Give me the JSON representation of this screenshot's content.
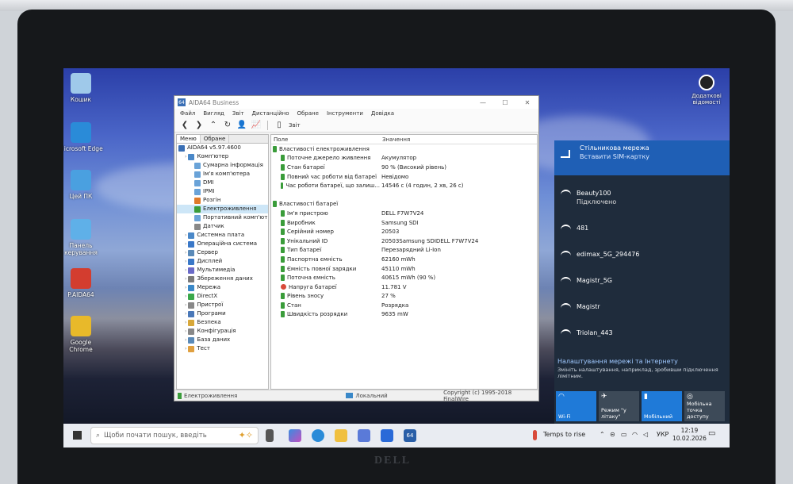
{
  "desktop": {
    "icons": [
      {
        "label": "Кошик",
        "icon": "recycle-bin-icon",
        "color": "#9fc9ea"
      },
      {
        "label": "Microsoft Edge",
        "icon": "edge-icon",
        "color": "#2a8bd8"
      },
      {
        "label": "Цей ПК",
        "icon": "this-pc-icon",
        "color": "#4aa0e0"
      },
      {
        "label": "Панель керування",
        "icon": "control-panel-icon",
        "color": "#5fb0e8"
      },
      {
        "label": "P.AIDA64",
        "icon": "aida64-icon",
        "color": "#d33d2f"
      },
      {
        "label": "Google Chrome",
        "icon": "chrome-icon",
        "color": "#e8b92a"
      }
    ],
    "top_right_label": "Додаткові відомості"
  },
  "window": {
    "title": "AIDA64 Business",
    "icon_text": "64",
    "menu": [
      "Файл",
      "Вигляд",
      "Звіт",
      "Дистанційно",
      "Обране",
      "Інструменти",
      "Довідка"
    ],
    "toolbar_report": "Звіт",
    "tabs": [
      "Меню",
      "Обране"
    ],
    "tree": [
      {
        "label": "AIDA64 v5.97.4600",
        "level": 0,
        "color": "#3a6fb5"
      },
      {
        "label": "Комп'ютер",
        "level": 1,
        "color": "#4a88c8"
      },
      {
        "label": "Сумарна інформація",
        "level": 2,
        "color": "#6aa3d8"
      },
      {
        "label": "Ім'я комп'ютера",
        "level": 2,
        "color": "#6aa3d8"
      },
      {
        "label": "DMI",
        "level": 2,
        "color": "#6aa3d8"
      },
      {
        "label": "IPMI",
        "level": 2,
        "color": "#6aa3d8"
      },
      {
        "label": "Розгін",
        "level": 2,
        "color": "#e07a2a"
      },
      {
        "label": "Електроживлення",
        "level": 2,
        "color": "#3a9c3a",
        "selected": true
      },
      {
        "label": "Портативний комп'ют",
        "level": 2,
        "color": "#6aa3d8"
      },
      {
        "label": "Датчик",
        "level": 2,
        "color": "#888888"
      },
      {
        "label": "Системна плата",
        "level": 1,
        "color": "#4a88c8"
      },
      {
        "label": "Операційна система",
        "level": 1,
        "color": "#3a78c8"
      },
      {
        "label": "Сервер",
        "level": 1,
        "color": "#5a8ab8"
      },
      {
        "label": "Дисплей",
        "level": 1,
        "color": "#3a78c8"
      },
      {
        "label": "Мультимедіа",
        "level": 1,
        "color": "#6a6ac8"
      },
      {
        "label": "Збереження даних",
        "level": 1,
        "color": "#7a7a7a"
      },
      {
        "label": "Мережа",
        "level": 1,
        "color": "#3a88c8"
      },
      {
        "label": "DirectX",
        "level": 1,
        "color": "#3aa84a"
      },
      {
        "label": "Пристрої",
        "level": 1,
        "color": "#888888"
      },
      {
        "label": "Програми",
        "level": 1,
        "color": "#4a78b8"
      },
      {
        "label": "Безпека",
        "level": 1,
        "color": "#d8a83a"
      },
      {
        "label": "Конфігурація",
        "level": 1,
        "color": "#888888"
      },
      {
        "label": "База даних",
        "level": 1,
        "color": "#5a8ab8"
      },
      {
        "label": "Тест",
        "level": 1,
        "color": "#e0a040"
      }
    ],
    "columns": {
      "field": "Поле",
      "value": "Значення"
    },
    "rows": [
      {
        "field": "Властивості електроживлення",
        "value": "",
        "group": true
      },
      {
        "field": "Поточне джерело живлення",
        "value": "Акумулятор"
      },
      {
        "field": "Стан батареї",
        "value": "90 % (Високий рівень)"
      },
      {
        "field": "Повний час роботи від батареї",
        "value": "Невідомо"
      },
      {
        "field": "Час роботи батареї, що залиш...",
        "value": "14546 с (4 годин, 2 хв, 26 с)"
      },
      {
        "field": "",
        "value": "",
        "blank": true
      },
      {
        "field": "Властивості батареї",
        "value": "",
        "group": true
      },
      {
        "field": "Ім'я пристрою",
        "value": "DELL F7W7V24"
      },
      {
        "field": "Виробник",
        "value": "Samsung SDI"
      },
      {
        "field": "Серійний номер",
        "value": "20503"
      },
      {
        "field": "Унікальний ID",
        "value": "20503Samsung SDIDELL F7W7V24"
      },
      {
        "field": "Тип батареї",
        "value": "Перезарядний Li-Ion"
      },
      {
        "field": "Паспортна ємність",
        "value": "62160 mWh"
      },
      {
        "field": "Ємність повної зарядки",
        "value": "45110 mWh"
      },
      {
        "field": "Поточна ємність",
        "value": "40615 mWh  (90 %)"
      },
      {
        "field": "Напруга батареї",
        "value": "11.781 V"
      },
      {
        "field": "Рівень зносу",
        "value": "27 %"
      },
      {
        "field": "Стан",
        "value": "Розрядка"
      },
      {
        "field": "Швидкість розрядки",
        "value": "9635 mW"
      }
    ],
    "status": {
      "left": "Електроживлення",
      "mid": "Локальний",
      "right": "Copyright (c) 1995-2018 FinalWire"
    }
  },
  "network": {
    "cellular_title": "Стільникова мережа",
    "cellular_sub": "Вставити SIM-картку",
    "networks": [
      {
        "name": "Beauty100",
        "sub": "Підключено"
      },
      {
        "name": "481",
        "sub": ""
      },
      {
        "name": "edimax_5G_294476",
        "sub": ""
      },
      {
        "name": "Magistr_5G",
        "sub": ""
      },
      {
        "name": "Magistr",
        "sub": ""
      },
      {
        "name": "Triolan_443",
        "sub": ""
      }
    ],
    "settings_title": "Налаштування мережі та Інтернету",
    "settings_desc": "Змініть налаштування, наприклад, зробивши підключення лімітним.",
    "quick": [
      {
        "label": "Wi-Fi",
        "active": true
      },
      {
        "label": "Режим \"у літаку\"",
        "active": false
      },
      {
        "label": "Мобільний",
        "active": true
      },
      {
        "label": "Мобільна точка доступу",
        "active": false
      }
    ]
  },
  "taskbar": {
    "search_placeholder": "Щоби почати пошук, введіть",
    "weather": "Temps to rise",
    "lang": "УКР",
    "time": "12:19",
    "date": "10.02.2026"
  }
}
